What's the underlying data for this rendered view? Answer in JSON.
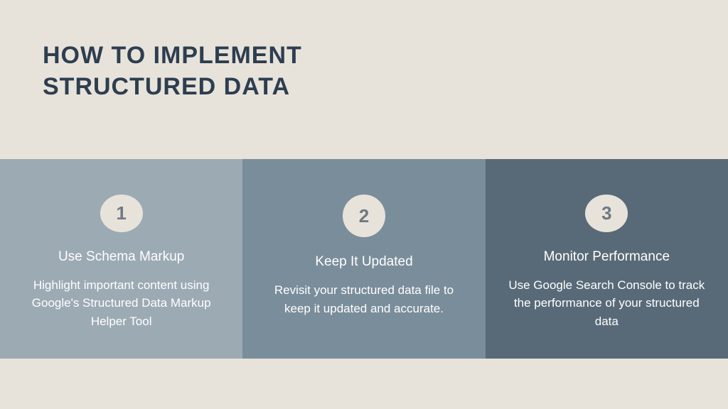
{
  "header": {
    "title_line1": "HOW TO IMPLEMENT",
    "title_line2": "STRUCTURED DATA"
  },
  "cards": [
    {
      "number": "1",
      "title": "Use Schema Markup",
      "description": "Highlight important content using Google's Structured Data Markup Helper Tool"
    },
    {
      "number": "2",
      "title": "Keep It Updated",
      "description": "Revisit your structured data file to keep it updated and accurate."
    },
    {
      "number": "3",
      "title": "Monitor Performance",
      "description": "Use Google Search Console to track the performance of your structured data"
    }
  ],
  "colors": {
    "background": "#e8e3da",
    "title": "#2d3e50",
    "card1": "#9caab4",
    "card2": "#7a8d9b",
    "card3": "#586a77"
  }
}
